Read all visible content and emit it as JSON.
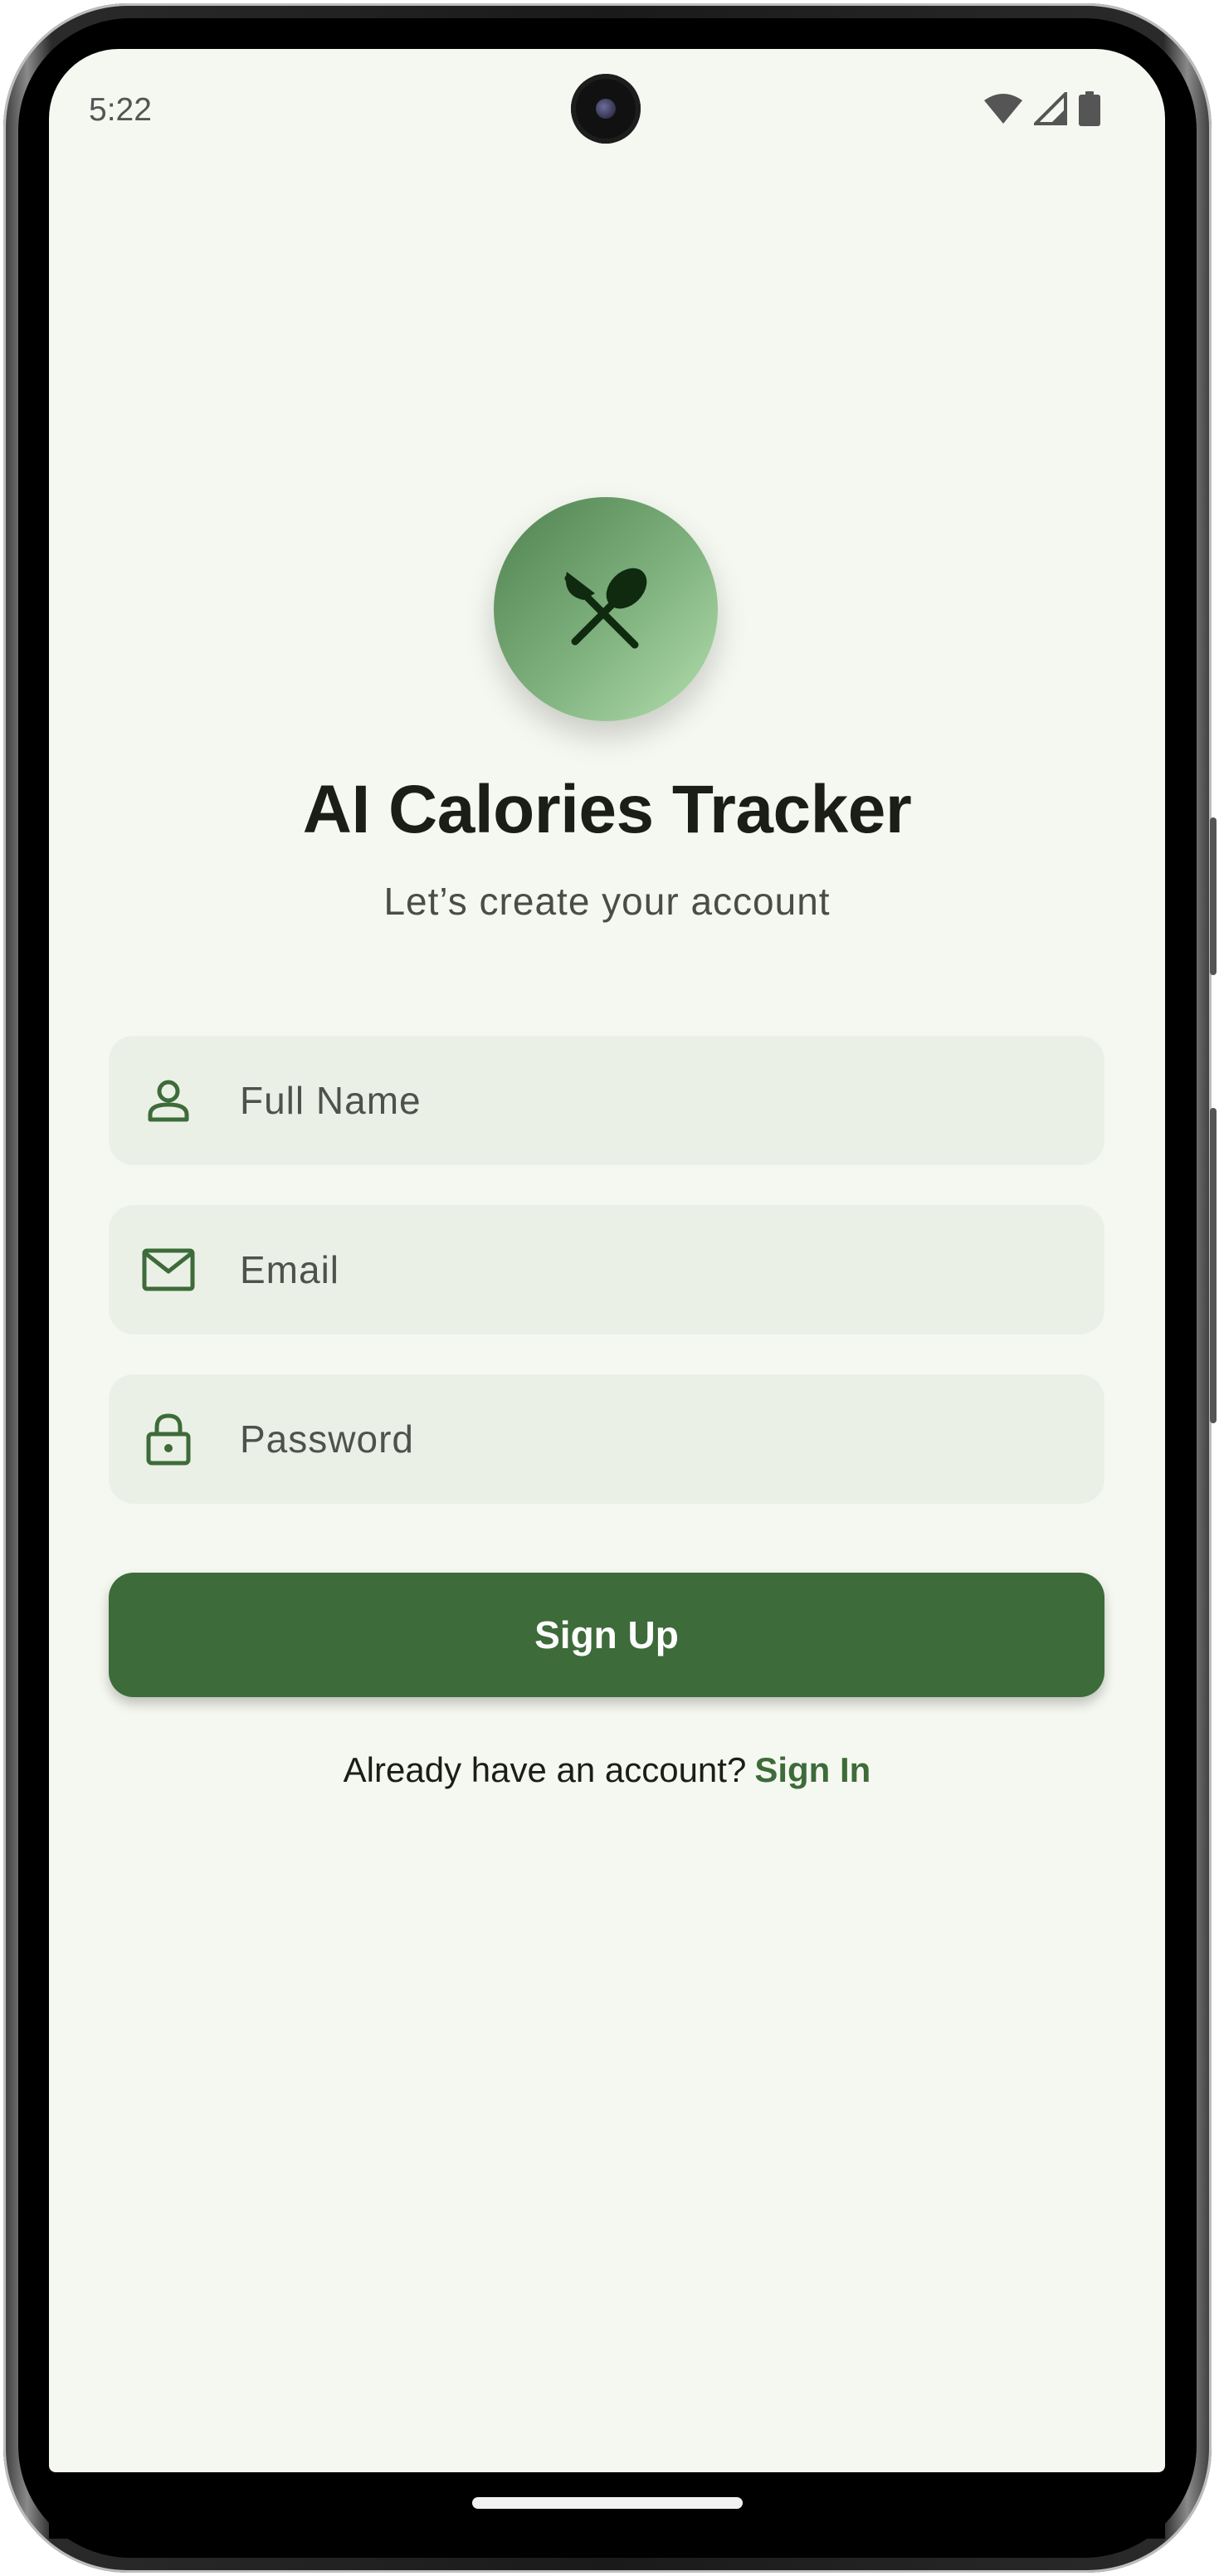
{
  "status_bar": {
    "time": "5:22",
    "icons": [
      "wifi-icon",
      "cellular-signal-icon",
      "battery-icon"
    ]
  },
  "app": {
    "logo_icon": "fork-spoon-icon",
    "title": "AI Calories Tracker",
    "subtitle": "Let’s create your account"
  },
  "form": {
    "full_name": {
      "icon": "person-icon",
      "placeholder": "Full Name",
      "value": ""
    },
    "email": {
      "icon": "mail-icon",
      "placeholder": "Email",
      "value": ""
    },
    "password": {
      "icon": "lock-icon",
      "placeholder": "Password",
      "value": ""
    },
    "submit_label": "Sign Up"
  },
  "footer": {
    "prompt": "Already have an account?",
    "link_label": "Sign In"
  },
  "colors": {
    "background": "#f5f8f0",
    "primary": "#3d6b3a",
    "field_background": "#ebf0e6",
    "text": "#1b1d19"
  }
}
